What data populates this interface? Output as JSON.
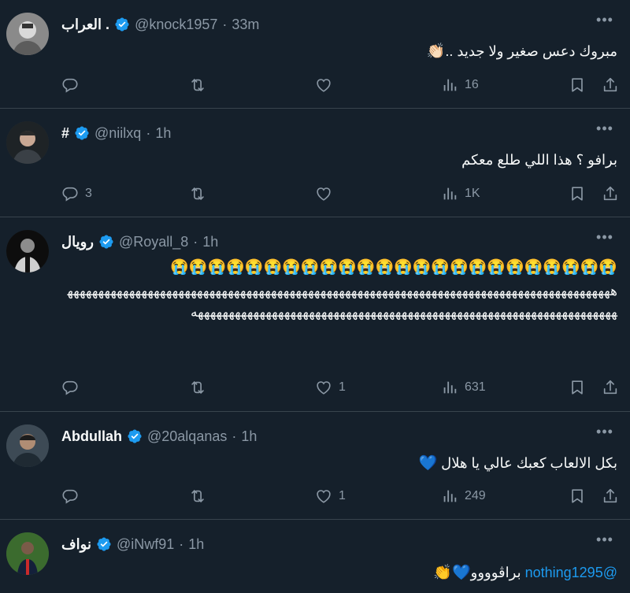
{
  "colors": {
    "background": "#15202b",
    "accent": "#1d9bf0",
    "muted": "#8b98a5",
    "divider": "#38444d",
    "heart_emoji": "#5fa8e6"
  },
  "tweets": [
    {
      "name": "العراب .",
      "handle": "@knock1957",
      "separator": "·",
      "time": "33m",
      "text": "مبروك دعس صغير ولا جديد ..",
      "emoji": "👏🏻",
      "replies": "",
      "retweets": "",
      "likes": "",
      "views": "16"
    },
    {
      "name": "#",
      "handle": "@niilxq",
      "separator": "·",
      "time": "1h",
      "text": "برافو ؟ هذا اللي طلع معكم",
      "replies": "3",
      "retweets": "",
      "likes": "",
      "views": "1K"
    },
    {
      "name": "رويال",
      "handle": "@Royall_8",
      "separator": "·",
      "time": "1h",
      "emoji_line": "😭😭😭😭😭😭😭😭😭😭😭😭😭😭😭😭😭😭😭😭😭😭😭😭",
      "text": "هههههههههههههههههههههههههههههههههههههههههههههههههههههههههههههههههههههههههههههههههههههههههههههههههههههههههههههههههههههههههههههههههههههههههههههههههههههههههههههه",
      "replies": "",
      "retweets": "",
      "likes": "1",
      "views": "631"
    },
    {
      "name": "Abdullah",
      "handle": "@20alqanas",
      "separator": "·",
      "time": "1h",
      "text": "بكل الالعاب كعبك عالي يا هلال",
      "emoji": "💙",
      "replies": "",
      "retweets": "",
      "likes": "1",
      "views": "249"
    },
    {
      "name": "نواف",
      "handle": "@iNwf91",
      "separator": "·",
      "time": "1h",
      "mention": "@nothing1295",
      "text": "براڤوووو",
      "emoji": "💙👏",
      "replies": "",
      "retweets": "",
      "likes": "",
      "views": ""
    }
  ],
  "icons": {
    "reply": "reply-icon",
    "retweet": "retweet-icon",
    "like": "heart-icon",
    "views": "views-icon",
    "bookmark": "bookmark-icon",
    "share": "share-icon",
    "more": "more-icon",
    "verified": "verified-badge-icon"
  }
}
